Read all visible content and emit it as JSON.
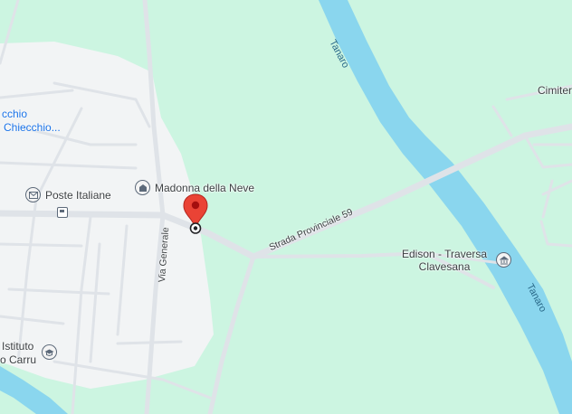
{
  "map": {
    "water_color": "#8ad6ee",
    "land_color": "#ccf5e1",
    "urban_color": "#f2f4f5",
    "road_color": "#dfe3e8",
    "pin_color": "#ea4335",
    "labels": {
      "river_north": "Tanaro",
      "river_south": "Tanaro",
      "road_provinciale": "Strada Provinciale 59",
      "road_generale": "Via Generale",
      "cemetery_partial": "Cimiter",
      "chiecchio_top": "cchio",
      "chiecchio_bottom": "Chiecchio...",
      "istituto_line1": "Istituto",
      "istituto_line2": "o Carru"
    },
    "pois": {
      "poste": {
        "name": "Poste Italiane",
        "icon": "mail-icon"
      },
      "madonna": {
        "name": "Madonna della Neve",
        "icon": "church-icon"
      },
      "edison_line1": "Edison - Traversa",
      "edison_line2": "Clavesana",
      "edison_icon": "landmark-icon",
      "bus_icon": "bus-stop-icon",
      "istituto_icon": "school-icon",
      "pin_icon": "map-pin-icon"
    }
  }
}
